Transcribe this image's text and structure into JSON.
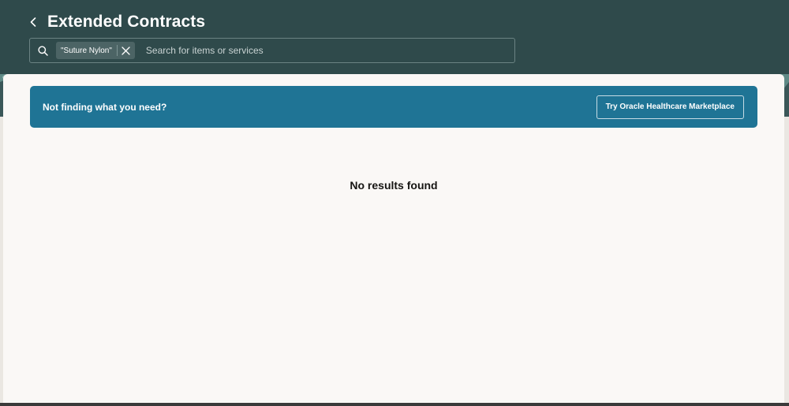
{
  "header": {
    "title": "Extended Contracts",
    "back_icon": "chevron-left-icon"
  },
  "search": {
    "chip_label": "\"Suture Nylon\"",
    "placeholder": "Search for items or services",
    "value": ""
  },
  "banner": {
    "text": "Not finding what you need?",
    "button_label": "Try Oracle Healthcare Marketplace"
  },
  "results": {
    "empty_message": "No results found"
  },
  "colors": {
    "header_bg": "#2f4a4b",
    "banner_bg": "#1f7495",
    "content_bg": "#faf8f6"
  }
}
